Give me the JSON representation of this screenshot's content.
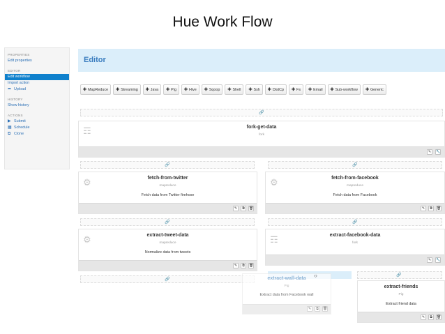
{
  "slide": {
    "title": "Hue Work Flow"
  },
  "sidebar": {
    "sections": [
      {
        "header": "PROPERTIES",
        "items": [
          {
            "label": "Edit properties",
            "icon": "",
            "active": false
          }
        ]
      },
      {
        "header": "EDITOR",
        "items": [
          {
            "label": "Edit workflow",
            "icon": "",
            "active": true
          },
          {
            "label": "Import action",
            "icon": "",
            "active": false
          },
          {
            "label": "Upload",
            "icon": "share-icon",
            "active": false
          }
        ]
      },
      {
        "header": "HISTORY",
        "items": [
          {
            "label": "Show history",
            "icon": "",
            "active": false
          }
        ]
      },
      {
        "header": "ACTIONS",
        "items": [
          {
            "label": "Submit",
            "icon": "play-icon",
            "active": false
          },
          {
            "label": "Schedule",
            "icon": "calendar-icon",
            "active": false
          },
          {
            "label": "Clone",
            "icon": "copy-icon",
            "active": false
          }
        ]
      }
    ]
  },
  "editor": {
    "title": "Editor"
  },
  "toolbar": {
    "buttons": [
      "MapReduce",
      "Streaming",
      "Java",
      "Pig",
      "Hive",
      "Sqoop",
      "Shell",
      "Ssh",
      "DistCp",
      "Fs",
      "Email",
      "Sub-workflow",
      "Generic"
    ]
  },
  "nodes": {
    "fork": {
      "name": "fork-get-data",
      "type": "fork"
    },
    "twitter": {
      "name": "fetch-from-twitter",
      "type": "mapreduce",
      "desc": "Fetch data from Twitter firehose"
    },
    "facebook": {
      "name": "fetch-from-facebook",
      "type": "mapreduce",
      "desc": "Fetch data from Facebook"
    },
    "tweet": {
      "name": "extract-tweet-data",
      "type": "mapreduce",
      "desc": "Normalize data from tweets"
    },
    "fbdata": {
      "name": "extract-facebook-data",
      "type": "fork"
    },
    "wall": {
      "name": "extract-wall-data",
      "type": "Pig",
      "desc": "Extract data from Facebook wall"
    },
    "friends": {
      "name": "extract-friends",
      "type": "Pig",
      "desc": "Extract friend data"
    }
  },
  "colors": {
    "accent": "#0f80cc",
    "header_bg": "#dbeefa",
    "link": "#2a6fb5"
  }
}
